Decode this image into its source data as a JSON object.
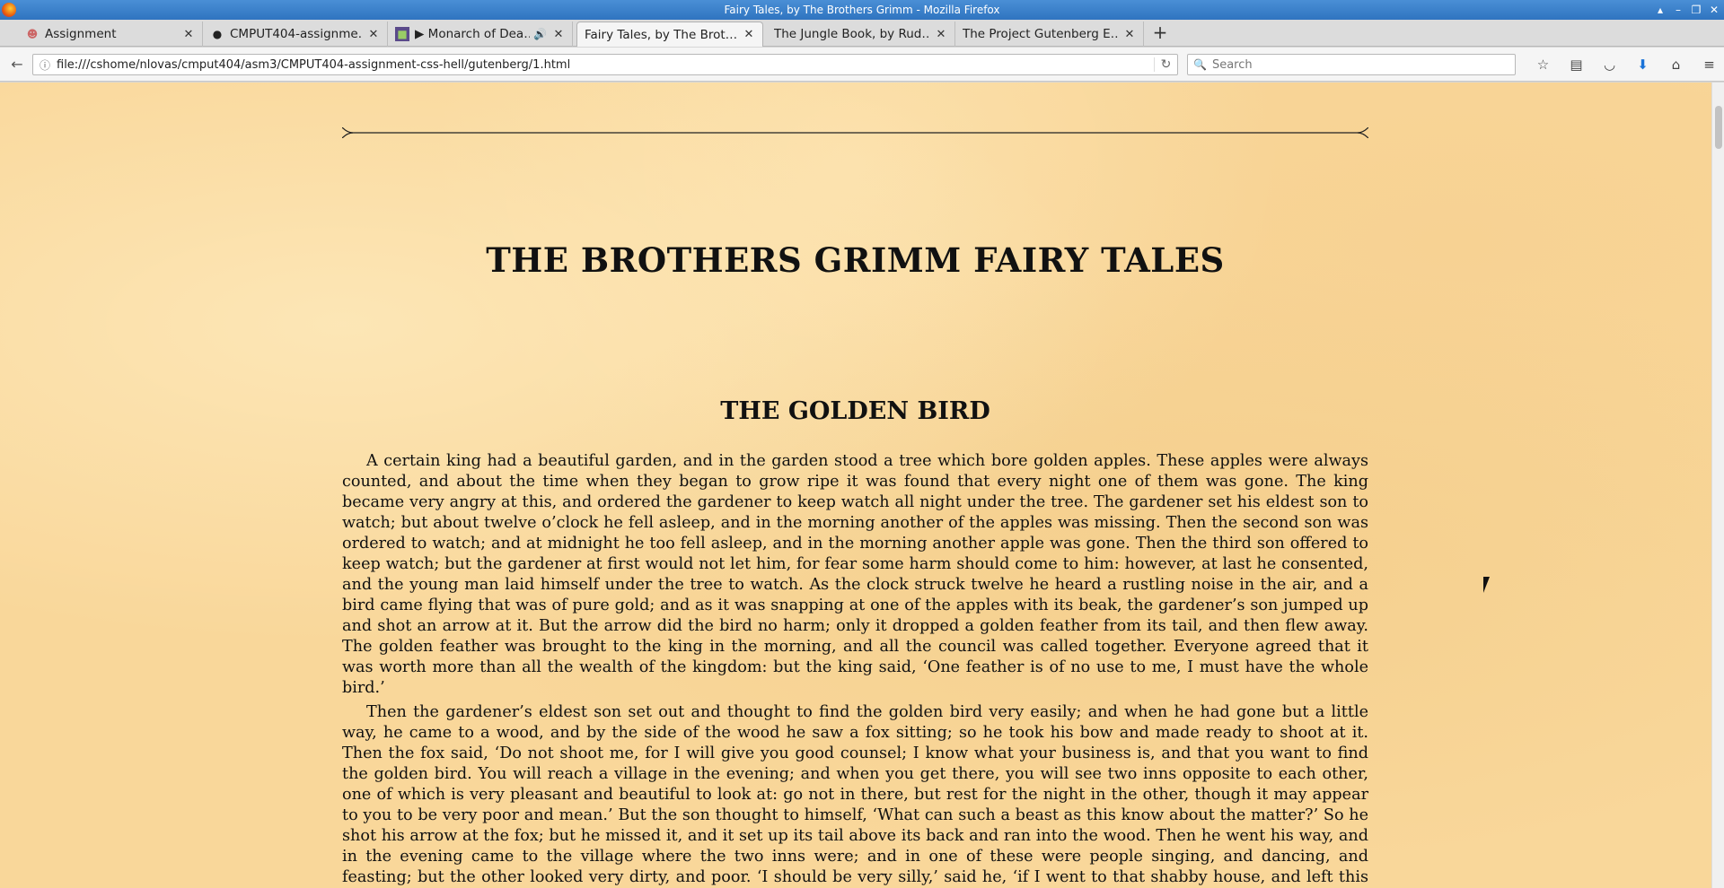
{
  "window": {
    "title": "Fairy Tales, by The Brothers Grimm - Mozilla Firefox"
  },
  "tabs": [
    {
      "label": "Assignment",
      "icon": "assignment-favicon-icon"
    },
    {
      "label": "CMPUT404-assignme…",
      "icon": "github-icon"
    },
    {
      "label": "▶ Monarch of Dea…",
      "icon": "video-favicon-icon",
      "audio": "🔊"
    },
    {
      "label": "Fairy Tales, by The Brot…",
      "active": true
    },
    {
      "label": "The Jungle Book, by Rud…"
    },
    {
      "label": "The Project Gutenberg E…"
    }
  ],
  "navbar": {
    "url": "file:///cshome/nlovas/cmput404/asm3/CMPUT404-assignment-css-hell/gutenberg/1.html",
    "search_placeholder": "Search"
  },
  "page": {
    "book_title": "THE BROTHERS GRIMM FAIRY TALES",
    "story_title": "THE GOLDEN BIRD",
    "paragraphs": [
      "A certain king had a beautiful garden, and in the garden stood a tree which bore golden apples. These apples were always counted, and about the time when they began to grow ripe it was found that every night one of them was gone. The king became very angry at this, and ordered the gardener to keep watch all night under the tree. The gardener set his eldest son to watch; but about twelve o’clock he fell asleep, and in the morning another of the apples was missing. Then the second son was ordered to watch; and at midnight he too fell asleep, and in the morning another apple was gone. Then the third son offered to keep watch; but the gardener at first would not let him, for fear some harm should come to him: however, at last he consented, and the young man laid himself under the tree to watch. As the clock struck twelve he heard a rustling noise in the air, and a bird came flying that was of pure gold; and as it was snapping at one of the apples with its beak, the gardener’s son jumped up and shot an arrow at it. But the arrow did the bird no harm; only it dropped a golden feather from its tail, and then flew away. The golden feather was brought to the king in the morning, and all the council was called together. Everyone agreed that it was worth more than all the wealth of the kingdom: but the king said, ‘One feather is of no use to me, I must have the whole bird.’",
      "Then the gardener’s eldest son set out and thought to find the golden bird very easily; and when he had gone but a little way, he came to a wood, and by the side of the wood he saw a fox sitting; so he took his bow and made ready to shoot at it. Then the fox said, ‘Do not shoot me, for I will give you good counsel; I know what your business is, and that you want to find the golden bird. You will reach a village in the evening; and when you get there, you will see two inns opposite to each other, one of which is very pleasant and beautiful to look at: go not in there, but rest for the night in the other, though it may appear to you to be very poor and mean.’ But the son thought to himself, ‘What can such a beast as this know about the matter?’ So he shot his arrow at the fox; but he missed it, and it set up its tail above its back and ran into the wood. Then he went his way, and in the evening came to the village where the two inns were; and in one of these were people singing, and dancing, and feasting; but the other looked very dirty, and poor. ‘I should be very silly,’ said he, ‘if I went to that shabby house, and left this charming place’; so he went into the smart house, and ate and drank at his ease, and forgot the bird, and his country too."
    ]
  }
}
